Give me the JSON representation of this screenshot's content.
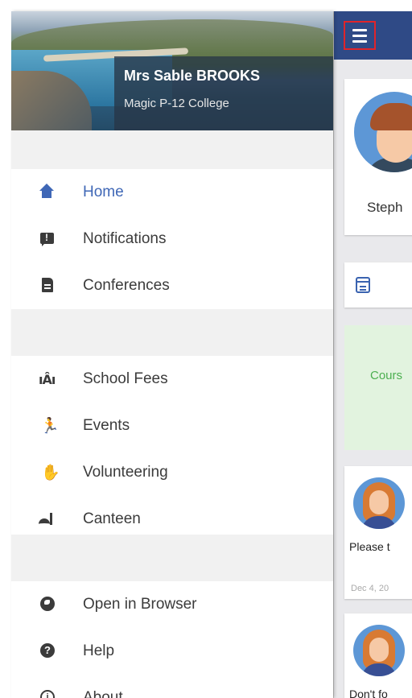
{
  "header": {
    "user_name": "Mrs Sable BROOKS",
    "school": "Magic P-12 College"
  },
  "menu": {
    "group1": [
      {
        "label": "Home",
        "icon": "home-icon",
        "active": true
      },
      {
        "label": "Notifications",
        "icon": "notification-alert-icon"
      },
      {
        "label": "Conferences",
        "icon": "document-icon"
      }
    ],
    "group2": [
      {
        "label": "School Fees",
        "icon": "school-fees-icon"
      },
      {
        "label": "Events",
        "icon": "running-figure-icon"
      },
      {
        "label": "Volunteering",
        "icon": "hand-icon"
      },
      {
        "label": "Canteen",
        "icon": "canteen-food-icon"
      }
    ],
    "group3": [
      {
        "label": "Open in Browser",
        "icon": "globe-icon"
      },
      {
        "label": "Help",
        "icon": "help-icon"
      },
      {
        "label": "About",
        "icon": "info-icon"
      }
    ]
  },
  "background": {
    "profile_name": "Steph",
    "course_text": "Cours",
    "message1_text": "Please t",
    "message1_date": "Dec 4, 20",
    "message2_text": "Don't fo"
  },
  "colors": {
    "app_bar": "#2f4a86",
    "active": "#3f67b6",
    "highlight_border": "#e0242a",
    "course_bg": "#e2f3df"
  },
  "glyphs": {
    "help": "?",
    "info": "i",
    "fees": "ıÂı",
    "run": "🏃",
    "hand": "✋"
  }
}
